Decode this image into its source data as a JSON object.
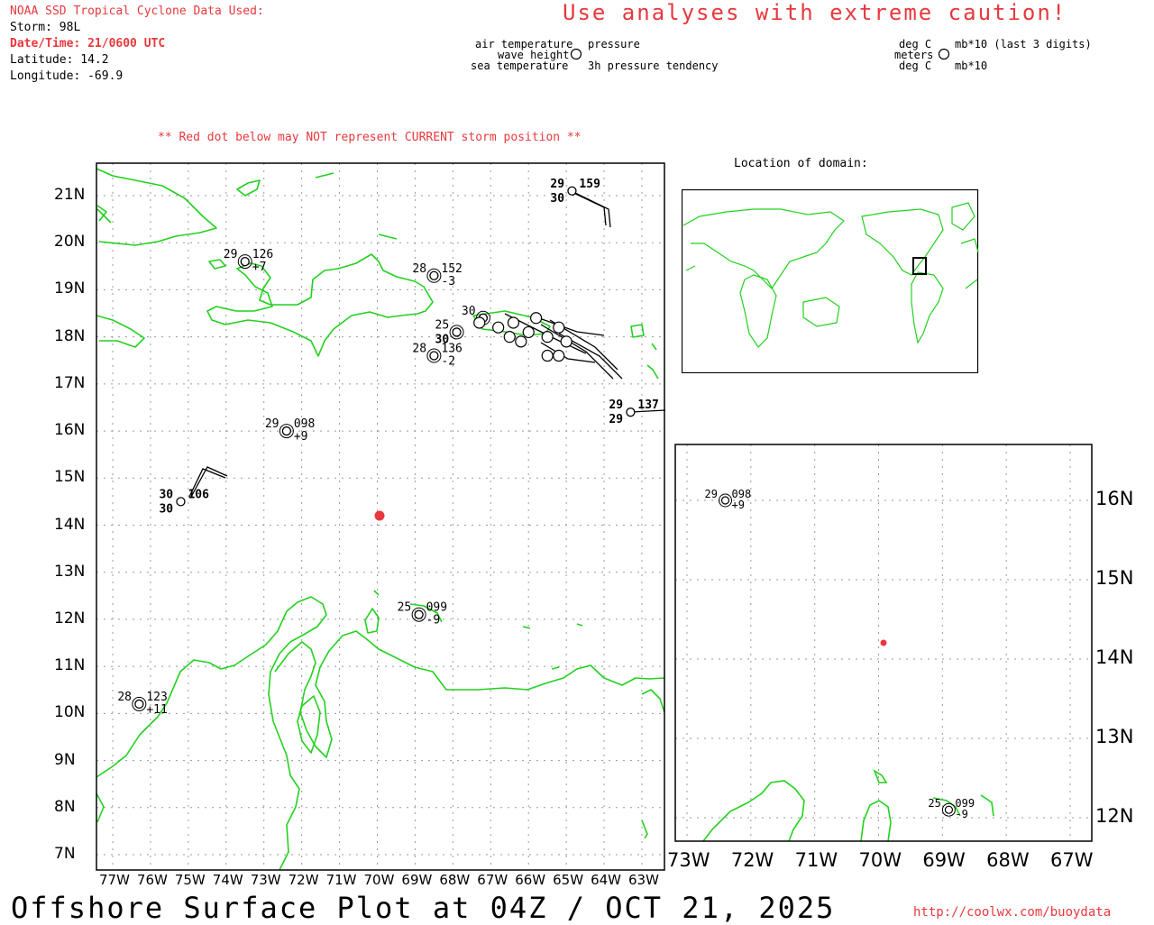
{
  "header": {
    "source": "NOAA SSD Tropical Cyclone Data Used:",
    "storm": "Storm: 98L",
    "datetime": "Date/Time: 21/0600 UTC",
    "latitude": "Latitude: 14.2",
    "longitude": "Longitude: -69.9",
    "caution": "Use analyses with extreme caution!",
    "red_dot_note": "** Red dot below may NOT represent CURRENT storm position **"
  },
  "legend": {
    "air_temperature": "air temperature",
    "wave_height": "wave height",
    "sea_temperature": "sea temperature",
    "pressure": "pressure",
    "pressure_tendency": "3h pressure tendency",
    "units_air": "deg C",
    "units_wave": "meters",
    "units_sea": "deg C",
    "units_pressure": "mb*10 (last 3 digits)",
    "units_tendency": "mb*10"
  },
  "inset": {
    "title": "Location of domain:"
  },
  "main_map": {
    "lat_labels": [
      "21N",
      "20N",
      "19N",
      "18N",
      "17N",
      "16N",
      "15N",
      "14N",
      "13N",
      "12N",
      "11N",
      "10N",
      "9N",
      "8N",
      "7N"
    ],
    "lon_labels": [
      "77W",
      "76W",
      "75W",
      "74W",
      "73W",
      "72W",
      "71W",
      "70W",
      "69W",
      "68W",
      "67W",
      "66W",
      "65W",
      "64W",
      "63W"
    ],
    "storm_position": {
      "lat": 14.2,
      "lon": -69.9
    },
    "stations": [
      {
        "air": "29",
        "pressure": "159",
        "sea": "30",
        "tendency": ""
      },
      {
        "air": "29",
        "pressure": "126",
        "sea": "",
        "tendency": "+7"
      },
      {
        "air": "28",
        "pressure": "152",
        "sea": "",
        "tendency": "-3"
      },
      {
        "air": "28",
        "pressure": "136",
        "sea": "",
        "tendency": "-2"
      },
      {
        "air": "29",
        "pressure": "098",
        "sea": "",
        "tendency": "+9"
      },
      {
        "air": "30",
        "pressure": "106",
        "sea": "30",
        "tendency": ""
      },
      {
        "air": "29",
        "pressure": "137",
        "sea": "29",
        "tendency": ""
      },
      {
        "air": "25",
        "pressure": "099",
        "sea": "",
        "tendency": "-9"
      },
      {
        "air": "28",
        "pressure": "123",
        "sea": "",
        "tendency": "+11"
      },
      {
        "air": "25",
        "pressure": "",
        "sea": "30",
        "tendency": ""
      },
      {
        "air": "30",
        "pressure": "",
        "sea": "",
        "tendency": ""
      }
    ]
  },
  "zoom_map": {
    "lat_labels": [
      "16N",
      "15N",
      "14N",
      "13N",
      "12N"
    ],
    "lon_labels": [
      "73W",
      "72W",
      "71W",
      "70W",
      "69W",
      "68W",
      "67W"
    ],
    "stations": [
      {
        "air": "29",
        "pressure": "098",
        "tendency": "+9"
      },
      {
        "air": "25",
        "pressure": "099",
        "tendency": "-9"
      }
    ]
  },
  "footer": {
    "title": "Offshore Surface Plot at 04Z / OCT 21, 2025",
    "url": "http://coolwx.com/buoydata"
  },
  "colors": {
    "land": "#22d11f",
    "accent": "#e8383d",
    "grid": "#9a9a9a"
  }
}
